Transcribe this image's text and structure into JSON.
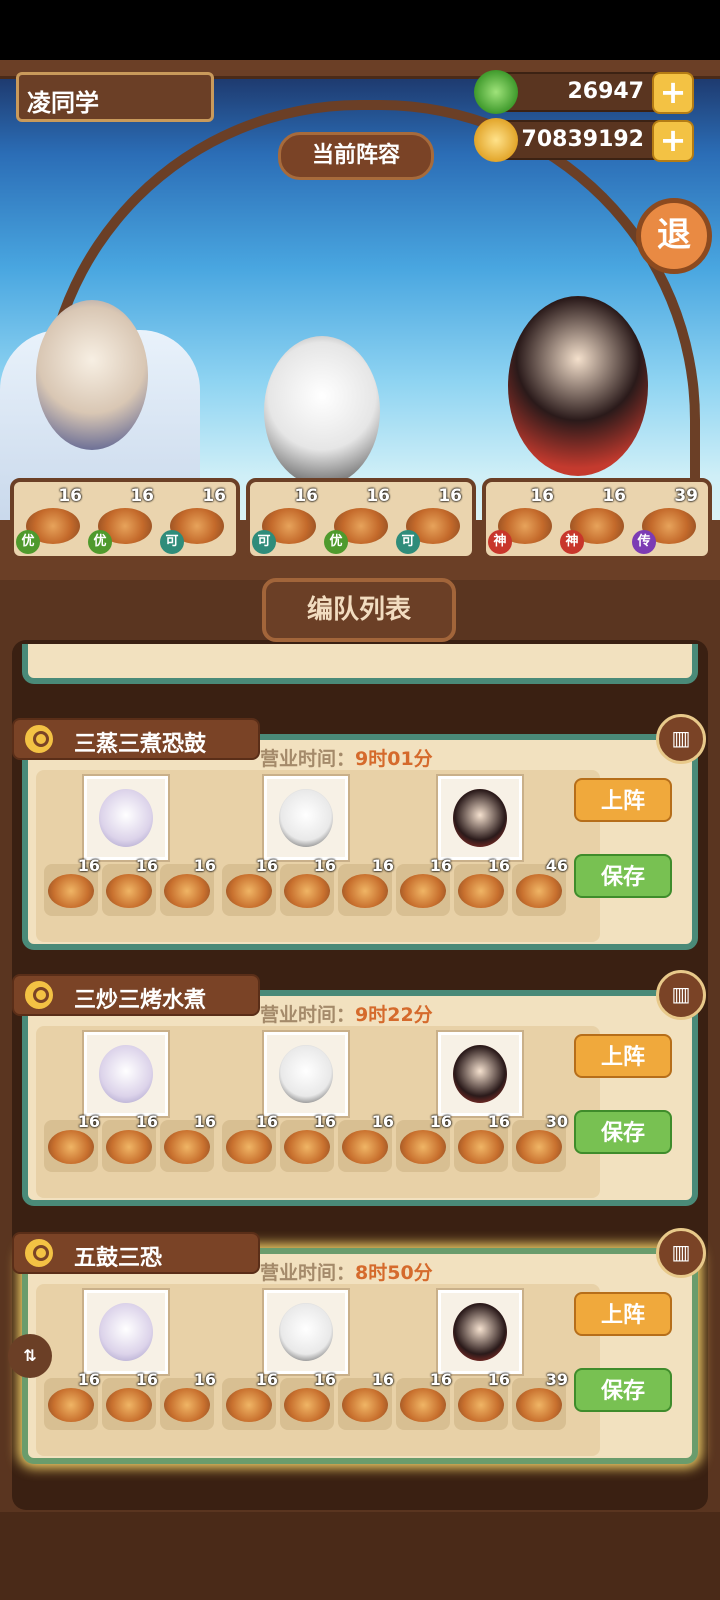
{
  "player": {
    "name": "凌同学"
  },
  "currency": {
    "jade": "26947",
    "gold": "70839192"
  },
  "stage": {
    "sign": "当前阵容",
    "exit_label": "退"
  },
  "current_lineup": [
    {
      "dishes": [
        {
          "level": "16",
          "grade": "优"
        },
        {
          "level": "16",
          "grade": "优"
        },
        {
          "level": "16",
          "grade": "可"
        }
      ]
    },
    {
      "dishes": [
        {
          "level": "16",
          "grade": "可"
        },
        {
          "level": "16",
          "grade": "优"
        },
        {
          "level": "16",
          "grade": "可"
        }
      ]
    },
    {
      "dishes": [
        {
          "level": "16",
          "grade": "神"
        },
        {
          "level": "16",
          "grade": "神"
        },
        {
          "level": "39",
          "grade": "传"
        }
      ]
    }
  ],
  "list": {
    "title": "编队列表",
    "hours_prefix": "营业时间：",
    "up_label": "上阵",
    "save_label": "保存",
    "teams": [
      {
        "name": "三蒸三煮恐鼓",
        "hours": "9时01分",
        "dish_levels": [
          "16",
          "16",
          "16",
          "16",
          "16",
          "16",
          "16",
          "16",
          "46"
        ]
      },
      {
        "name": "三炒三烤水煮",
        "hours": "9时22分",
        "dish_levels": [
          "16",
          "16",
          "16",
          "16",
          "16",
          "16",
          "16",
          "16",
          "30"
        ]
      },
      {
        "name": "五鼓三恐",
        "hours": "8时50分",
        "dish_levels": [
          "16",
          "16",
          "16",
          "16",
          "16",
          "16",
          "16",
          "16",
          "39"
        ]
      }
    ]
  },
  "colors": {
    "grade_good": "#4f9a2d",
    "grade_ok": "#2f8c7a",
    "grade_god": "#c8362b",
    "grade_legend": "#7c3bb4"
  }
}
